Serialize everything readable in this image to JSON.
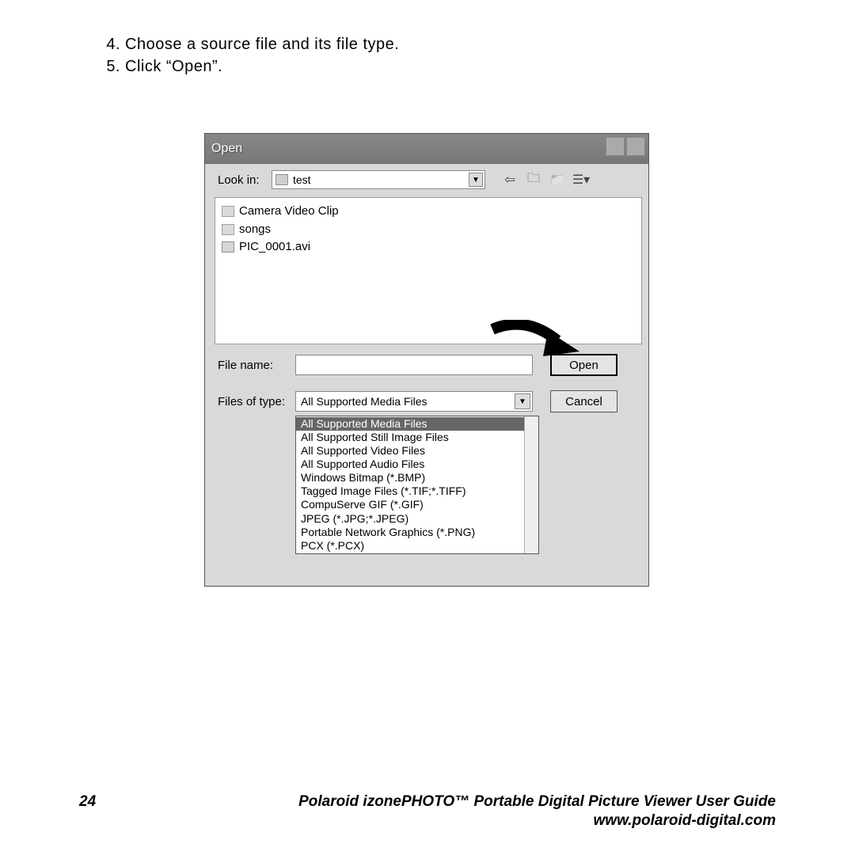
{
  "instructions": {
    "item4": {
      "num": "4.",
      "text": "Choose a source file and its file type."
    },
    "item5": {
      "num": "5.",
      "text": "Click “Open”."
    }
  },
  "dialog": {
    "title": "Open",
    "lookin_label": "Look in:",
    "lookin_value": "test",
    "files": {
      "f0": "Camera Video Clip",
      "f1": "songs",
      "f2": "PIC_0001.avi"
    },
    "filename_label": "File name:",
    "filename_value": "",
    "filetype_label": "Files of type:",
    "filetype_value": "All Supported Media Files",
    "open_btn": "Open",
    "cancel_btn": "Cancel",
    "options": {
      "o0": "All Supported Media Files",
      "o1": "All Supported Still Image Files",
      "o2": "All Supported Video Files",
      "o3": "All Supported Audio Files",
      "o4": "Windows Bitmap (*.BMP)",
      "o5": "Tagged Image Files (*.TIF;*.TIFF)",
      "o6": "CompuServe GIF (*.GIF)",
      "o7": "JPEG (*.JPG;*.JPEG)",
      "o8": "Portable Network Graphics (*.PNG)",
      "o9": "PCX (*.PCX)"
    }
  },
  "footer": {
    "page": "24",
    "title": "Polaroid izonePHOTO™ Portable Digital Picture Viewer User Guide",
    "url": "www.polaroid-digital.com"
  }
}
